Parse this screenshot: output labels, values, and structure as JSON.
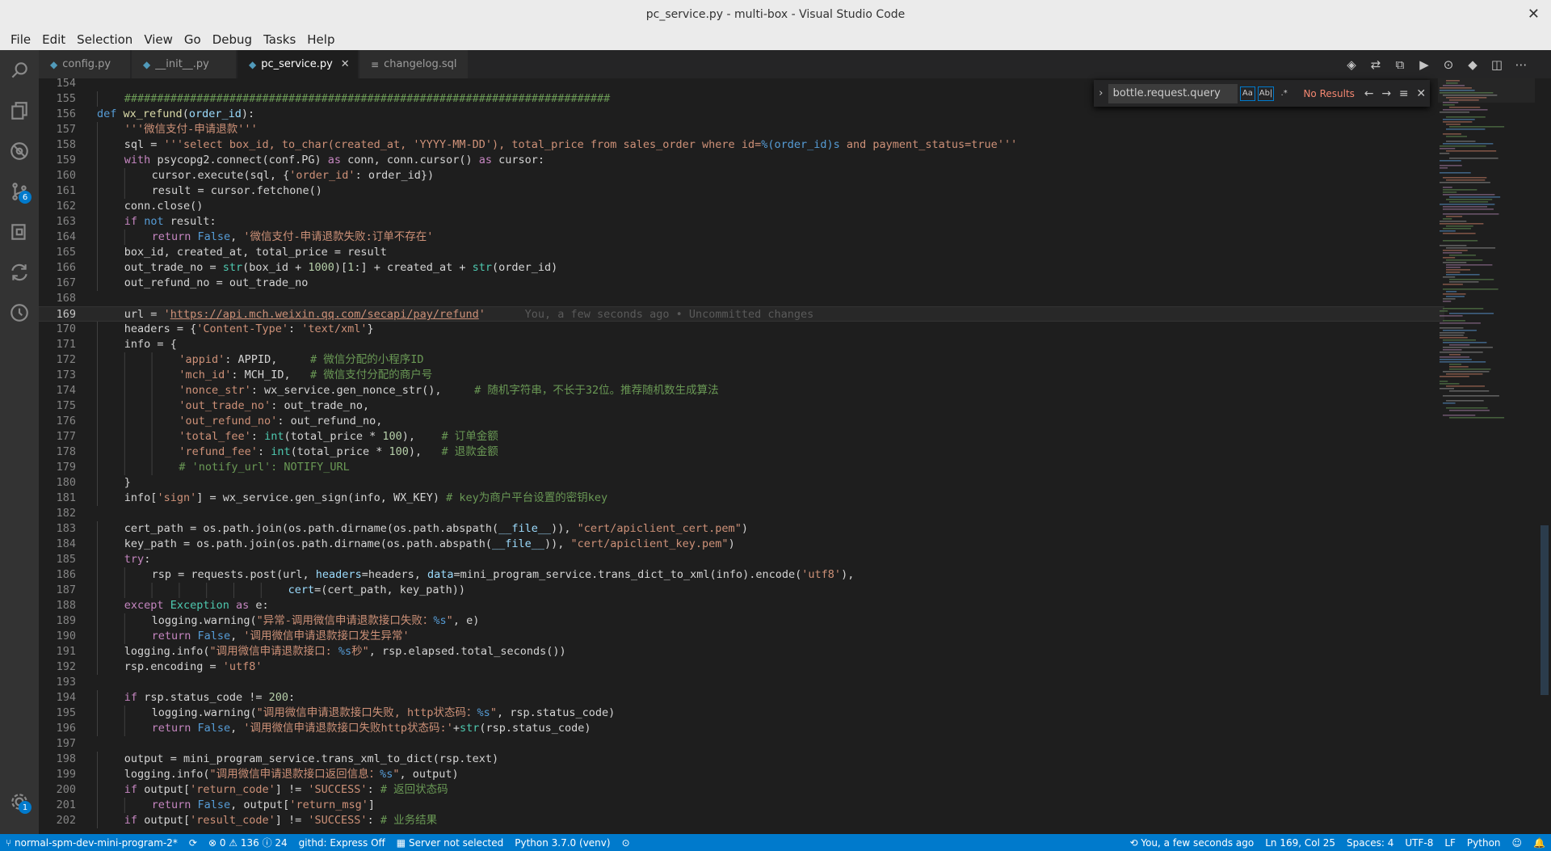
{
  "window": {
    "title": "pc_service.py - multi-box - Visual Studio Code"
  },
  "menu": [
    "File",
    "Edit",
    "Selection",
    "View",
    "Go",
    "Debug",
    "Tasks",
    "Help"
  ],
  "activity": {
    "items": [
      "search-icon",
      "explorer-icon",
      "debug-icon",
      "source-control-icon",
      "extensions-icon",
      "git-sync-icon",
      "history-icon"
    ],
    "source_control_badge": "6",
    "settings_badge": "1"
  },
  "tabs": [
    {
      "label": "config.py",
      "icon": "python-file-icon"
    },
    {
      "label": "__init__.py",
      "icon": "python-file-icon"
    },
    {
      "label": "pc_service.py",
      "icon": "python-file-icon",
      "active": true
    },
    {
      "label": "changelog.sql",
      "icon": "sql-file-icon"
    }
  ],
  "find": {
    "query": "bottle.request.query",
    "match_case": "Aa",
    "whole_word": "Ab|",
    "regex": ".*",
    "result": "No Results"
  },
  "editor": {
    "blame": "You, a few seconds ago • Uncommitted changes",
    "lines": [
      {
        "n": "154",
        "indent": 0,
        "html": ""
      },
      {
        "n": "155",
        "indent": 1,
        "html": "<span class=\"c\">##########################################################################</span>"
      },
      {
        "n": "156",
        "indent": 0,
        "html": "<span class=\"k\">def</span> <span class=\"f\">wx_refund</span>(<span class=\"v\">order_id</span>):"
      },
      {
        "n": "157",
        "indent": 1,
        "html": "<span class=\"s\">'''微信支付-申请退款'''</span>"
      },
      {
        "n": "158",
        "indent": 1,
        "html": "sql = <span class=\"s\">'''select box_id, to_char(created_at, 'YYYY-MM-DD'), total_price from sales_order where id=</span><span class=\"k\">%(order_id)s</span><span class=\"s\"> and payment_status=true'''</span>"
      },
      {
        "n": "159",
        "indent": 1,
        "html": "<span class=\"kw\">with</span> psycopg2.connect(conf.PG) <span class=\"kw\">as</span> conn, conn.cursor() <span class=\"kw\">as</span> cursor:"
      },
      {
        "n": "160",
        "indent": 2,
        "html": "cursor.execute(sql, {<span class=\"s\">'order_id'</span>: order_id})"
      },
      {
        "n": "161",
        "indent": 2,
        "html": "result = cursor.fetchone()"
      },
      {
        "n": "162",
        "indent": 1,
        "html": "conn.close()"
      },
      {
        "n": "163",
        "indent": 1,
        "html": "<span class=\"kw\">if</span> <span class=\"k\">not</span> result:"
      },
      {
        "n": "164",
        "indent": 2,
        "html": "<span class=\"kw\">return</span> <span class=\"k\">False</span>, <span class=\"s\">'微信支付-申请退款失败:订单不存在'</span>"
      },
      {
        "n": "165",
        "indent": 1,
        "html": "box_id, created_at, total_price = result"
      },
      {
        "n": "166",
        "indent": 1,
        "html": "out_trade_no = <span class=\"cl\">str</span>(box_id + <span class=\"n\">1000</span>)[<span class=\"n\">1</span>:] + created_at + <span class=\"cl\">str</span>(order_id)"
      },
      {
        "n": "167",
        "indent": 1,
        "html": "out_refund_no = out_trade_no"
      },
      {
        "n": "168",
        "indent": 0,
        "html": ""
      },
      {
        "n": "169",
        "indent": 1,
        "current": true,
        "html": "url = <span class=\"s\">'</span><span class=\"link\">https://api.mch.weixin.qq.com/secapi/pay/refund</span><span class=\"s\">'</span>"
      },
      {
        "n": "170",
        "indent": 1,
        "html": "headers = {<span class=\"s\">'Content-Type'</span>: <span class=\"s\">'text/xml'</span>}"
      },
      {
        "n": "171",
        "indent": 1,
        "html": "info = {"
      },
      {
        "n": "172",
        "indent": 3,
        "html": "<span class=\"s\">'appid'</span>: APPID,     <span class=\"c\"># 微信分配的小程序ID</span>"
      },
      {
        "n": "173",
        "indent": 3,
        "html": "<span class=\"s\">'mch_id'</span>: MCH_ID,   <span class=\"c\"># 微信支付分配的商户号</span>"
      },
      {
        "n": "174",
        "indent": 3,
        "html": "<span class=\"s\">'nonce_str'</span>: wx_service.gen_nonce_str(),     <span class=\"c\"># 随机字符串，不长于32位。推荐随机数生成算法</span>"
      },
      {
        "n": "175",
        "indent": 3,
        "html": "<span class=\"s\">'out_trade_no'</span>: out_trade_no,"
      },
      {
        "n": "176",
        "indent": 3,
        "html": "<span class=\"s\">'out_refund_no'</span>: out_refund_no,"
      },
      {
        "n": "177",
        "indent": 3,
        "html": "<span class=\"s\">'total_fee'</span>: <span class=\"cl\">int</span>(total_price * <span class=\"n\">100</span>),    <span class=\"c\"># 订单金额</span>"
      },
      {
        "n": "178",
        "indent": 3,
        "html": "<span class=\"s\">'refund_fee'</span>: <span class=\"cl\">int</span>(total_price * <span class=\"n\">100</span>),   <span class=\"c\"># 退款金额</span>"
      },
      {
        "n": "179",
        "indent": 3,
        "html": "<span class=\"c\"># 'notify_url': NOTIFY_URL</span>"
      },
      {
        "n": "180",
        "indent": 1,
        "html": "}"
      },
      {
        "n": "181",
        "indent": 1,
        "html": "info[<span class=\"s\">'sign'</span>] = wx_service.gen_sign(info, WX_KEY) <span class=\"c\"># key为商户平台设置的密钥key</span>"
      },
      {
        "n": "182",
        "indent": 0,
        "html": ""
      },
      {
        "n": "183",
        "indent": 1,
        "html": "cert_path = os.path.join(os.path.dirname(os.path.abspath(<span class=\"v\">__file__</span>)), <span class=\"s\">\"cert/apiclient_cert.pem\"</span>)"
      },
      {
        "n": "184",
        "indent": 1,
        "html": "key_path = os.path.join(os.path.dirname(os.path.abspath(<span class=\"v\">__file__</span>)), <span class=\"s\">\"cert/apiclient_key.pem\"</span>)"
      },
      {
        "n": "185",
        "indent": 1,
        "html": "<span class=\"kw\">try</span>:"
      },
      {
        "n": "186",
        "indent": 2,
        "html": "rsp = requests.post(url, <span class=\"v\">headers</span>=headers, <span class=\"v\">data</span>=mini_program_service.trans_dict_to_xml(info).encode(<span class=\"s\">'utf8'</span>),"
      },
      {
        "n": "187",
        "indent": 7,
        "html": "<span class=\"v\">cert</span>=(cert_path, key_path))"
      },
      {
        "n": "188",
        "indent": 1,
        "html": "<span class=\"kw\">except</span> <span class=\"cl\">Exception</span> <span class=\"kw\">as</span> e:"
      },
      {
        "n": "189",
        "indent": 2,
        "html": "logging.warning(<span class=\"s\">\"异常-调用微信申请退款接口失败：</span><span class=\"k\">%s</span><span class=\"s\">\"</span>, e)"
      },
      {
        "n": "190",
        "indent": 2,
        "html": "<span class=\"kw\">return</span> <span class=\"k\">False</span>, <span class=\"s\">'调用微信申请退款接口发生异常'</span>"
      },
      {
        "n": "191",
        "indent": 1,
        "html": "logging.info(<span class=\"s\">\"调用微信申请退款接口: </span><span class=\"k\">%s</span><span class=\"s\">秒\"</span>, rsp.elapsed.total_seconds())"
      },
      {
        "n": "192",
        "indent": 1,
        "html": "rsp.encoding = <span class=\"s\">'utf8'</span>"
      },
      {
        "n": "193",
        "indent": 0,
        "html": ""
      },
      {
        "n": "194",
        "indent": 1,
        "html": "<span class=\"kw\">if</span> rsp.status_code != <span class=\"n\">200</span>:"
      },
      {
        "n": "195",
        "indent": 2,
        "html": "logging.warning(<span class=\"s\">\"调用微信申请退款接口失败, http状态码：</span><span class=\"k\">%s</span><span class=\"s\">\"</span>, rsp.status_code)"
      },
      {
        "n": "196",
        "indent": 2,
        "html": "<span class=\"kw\">return</span> <span class=\"k\">False</span>, <span class=\"s\">'调用微信申请退款接口失败http状态码:'</span>+<span class=\"cl\">str</span>(rsp.status_code)"
      },
      {
        "n": "197",
        "indent": 0,
        "html": ""
      },
      {
        "n": "198",
        "indent": 1,
        "html": "output = mini_program_service.trans_xml_to_dict(rsp.text)"
      },
      {
        "n": "199",
        "indent": 1,
        "html": "logging.info(<span class=\"s\">\"调用微信申请退款接口返回信息：</span><span class=\"k\">%s</span><span class=\"s\">\"</span>, output)"
      },
      {
        "n": "200",
        "indent": 1,
        "html": "<span class=\"kw\">if</span> output[<span class=\"s\">'return_code'</span>] != <span class=\"s\">'SUCCESS'</span>: <span class=\"c\"># 返回状态码</span>"
      },
      {
        "n": "201",
        "indent": 2,
        "html": "<span class=\"kw\">return</span> <span class=\"k\">False</span>, output[<span class=\"s\">'return_msg'</span>]"
      },
      {
        "n": "202",
        "indent": 1,
        "html": "<span class=\"kw\">if</span> output[<span class=\"s\">'result_code'</span>] != <span class=\"s\">'SUCCESS'</span>: <span class=\"c\"># 业务结果</span>"
      }
    ]
  },
  "statusbar": {
    "branch": "normal-spm-dev-mini-program-2*",
    "errors": "0",
    "warnings": "136",
    "infos": "24",
    "githd": "githd: Express Off",
    "server": "Server not selected",
    "python": "Python 3.7.0 (venv)",
    "blame": "You, a few seconds ago",
    "position": "Ln 169, Col 25",
    "spaces": "Spaces: 4",
    "encoding": "UTF-8",
    "eol": "LF",
    "language": "Python"
  }
}
